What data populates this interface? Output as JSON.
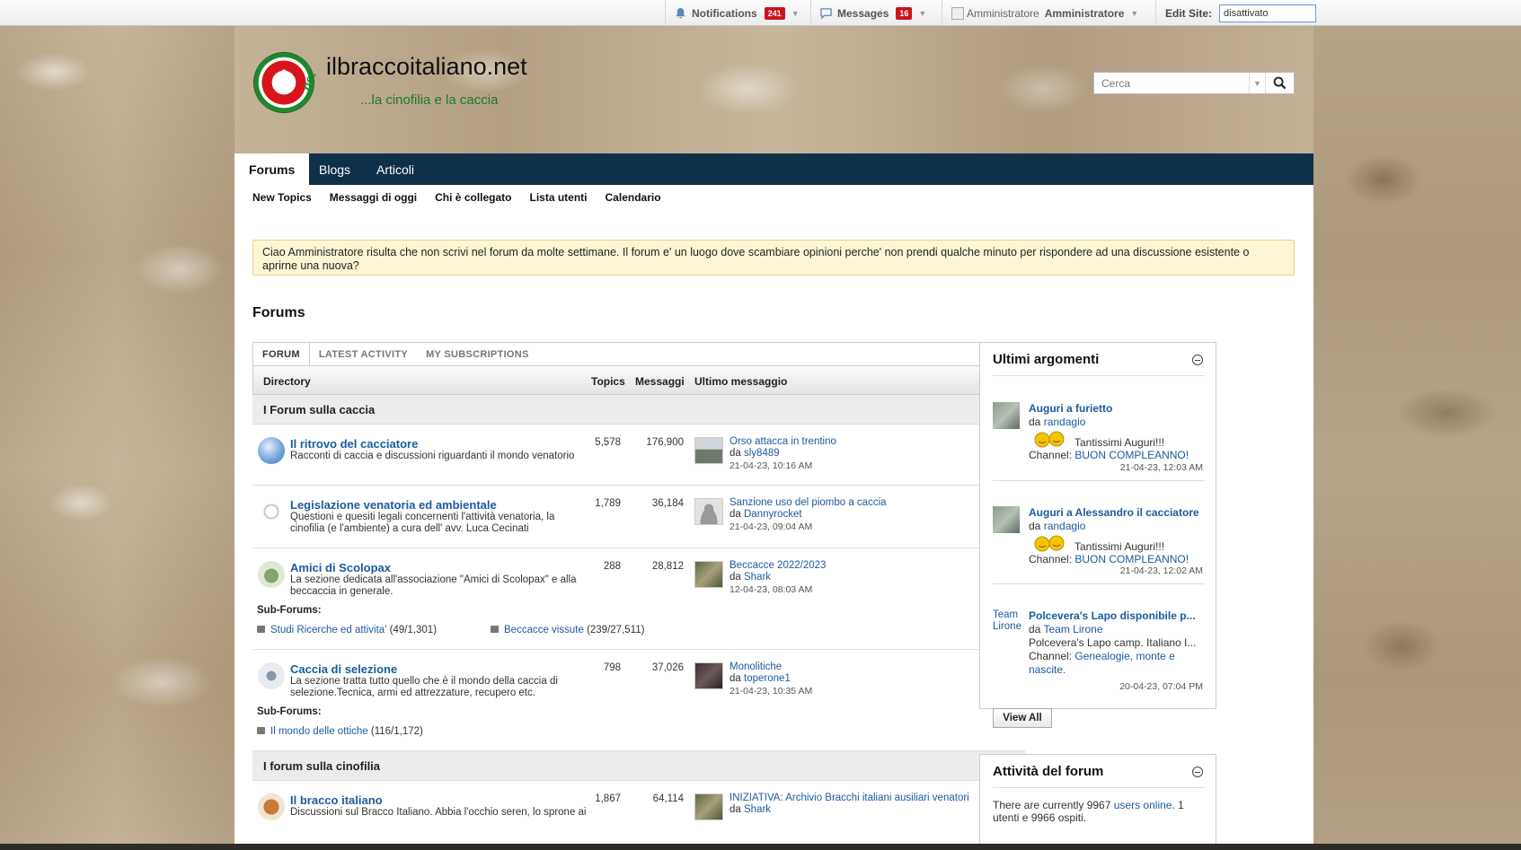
{
  "adminbar": {
    "notifications_label": "Notifications",
    "notifications_count": "241",
    "messages_label": "Messages",
    "messages_count": "16",
    "user_alt": "Amministratore",
    "user_label": "Amministratore",
    "edit_site_label": "Edit Site:",
    "edit_site_value": "disattivato"
  },
  "header": {
    "site_title": "ilbraccoitaliano.net",
    "tagline": "...la cinofilia e la caccia",
    "logo_letter": "i",
    "logo_suffix": ".net",
    "search_placeholder": "Cerca"
  },
  "nav": {
    "tabs": [
      {
        "label": "Forums",
        "active": true
      },
      {
        "label": "Blogs",
        "active": false
      },
      {
        "label": "Articoli",
        "active": false
      }
    ],
    "subnav": [
      "New Topics",
      "Messaggi di oggi",
      "Chi è collegato",
      "Lista utenti",
      "Calendario"
    ]
  },
  "notice": "Ciao Amministratore risulta che non scrivi nel forum da molte settimane. Il forum e' un luogo dove scambiare opinioni perche' non prendi qualche minuto per rispondere ad una discussione esistente o aprirne una nuova?",
  "page_title": "Forums",
  "forum_tabs": [
    "FORUM",
    "LATEST ACTIVITY",
    "MY SUBSCRIPTIONS"
  ],
  "columns": {
    "directory": "Directory",
    "topics": "Topics",
    "messages": "Messaggi",
    "last": "Ultimo messaggio"
  },
  "sub_forums_label": "Sub-Forums:",
  "categories": [
    {
      "title": "I Forum sulla caccia",
      "forums": [
        {
          "title": "Il ritrovo del cacciatore",
          "desc": "Racconti di caccia e discussioni riguardanti il mondo venatorio",
          "topics": "5,578",
          "messages": "176,900",
          "last_title": "Orso attacca in trentino",
          "by_prefix": "da",
          "last_user": "sly8489",
          "last_date": "21-04-23, 10:16 AM"
        },
        {
          "title": "Legislazione venatoria ed ambientale",
          "desc": "Questioni e quesiti legali concernenti l'attività venatoria, la cinofilia (e l'ambiente) a cura dell' avv. Luca Cecinati",
          "topics": "1,789",
          "messages": "36,184",
          "last_title": "Sanzione uso del piombo a caccia",
          "by_prefix": "da",
          "last_user": "Dannyrocket",
          "last_date": "21-04-23, 09:04 AM"
        },
        {
          "title": "Amici di Scolopax",
          "desc": "La sezione dedicata all'associazione \"Amici di Scolopax\" e alla beccaccia in generale.",
          "topics": "288",
          "messages": "28,812",
          "last_title": "Beccacce 2022/2023",
          "by_prefix": "da",
          "last_user": "Shark",
          "last_date": "12-04-23, 08:03 AM",
          "subforums": [
            {
              "name": "Studi Ricerche ed attivita'",
              "count": "(49/1,301)"
            },
            {
              "name": "Beccacce vissute",
              "count": "(239/27,511)"
            }
          ]
        },
        {
          "title": "Caccia di selezione",
          "desc": "La sezione tratta tutto quello che è il mondo della caccia di selezione.Tecnica, armi ed attrezzature, recupero etc.",
          "topics": "798",
          "messages": "37,026",
          "last_title": "Monolitiche",
          "by_prefix": "da",
          "last_user": "toperone1",
          "last_date": "21-04-23, 10:35 AM",
          "subforums": [
            {
              "name": "Il mondo delle ottiche",
              "count": "(116/1,172)"
            }
          ]
        }
      ]
    },
    {
      "title": "I forum sulla cinofilia",
      "forums": [
        {
          "title": "Il bracco italiano",
          "desc": "Discussioni sul Bracco Italiano. Abbia l'occhio seren, lo sprone ai",
          "topics": "1,867",
          "messages": "64,114",
          "last_title": "INIZIATIVA: Archivio Bracchi italiani ausiliari venatori",
          "by_prefix": "da",
          "last_user": "Shark",
          "last_date": ""
        }
      ]
    }
  ],
  "widget_latest": {
    "title": "Ultimi argomenti",
    "items": [
      {
        "title": "Auguri a furietto",
        "by_prefix": "da",
        "user": "randagio",
        "text": "Tantissimi Auguri!!!",
        "channel_label": "Channel:",
        "channel": "BUON COMPLEANNO!",
        "date": "21-04-23, 12:03 AM"
      },
      {
        "title": "Auguri a Alessandro il cacciatore",
        "by_prefix": "da",
        "user": "randagio",
        "text": "Tantissimi Auguri!!!",
        "channel_label": "Channel:",
        "channel": "BUON COMPLEANNO!",
        "date": "21-04-23, 12:02 AM"
      },
      {
        "title": "Polcevera's Lapo disponibile p...",
        "by_prefix": "da",
        "user": "Team Lirone",
        "avatar_alt": "Team Lirone",
        "text": "Polcevera's Lapo camp. Italiano I...",
        "channel_label": "Channel:",
        "channel": "Genealogie, monte e nascite.",
        "date": "20-04-23, 07:04 PM"
      }
    ],
    "view_all": "View All"
  },
  "widget_activity": {
    "title": "Attività del forum",
    "text_prefix": "There are currently 9967",
    "link": "users online.",
    "text_suffix": "1 utenti e 9966 ospiti."
  }
}
